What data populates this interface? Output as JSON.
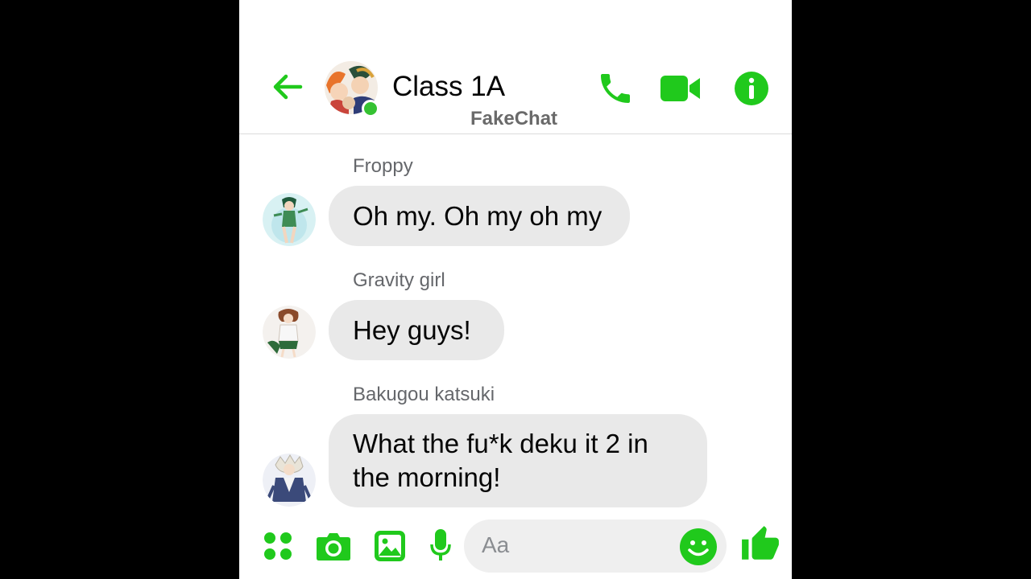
{
  "colors": {
    "accent": "#20c91c",
    "bubble": "#e9e9e9",
    "online": "#35c232",
    "name_gray": "#65676b"
  },
  "header": {
    "title": "Class 1A",
    "watermark": "FakeChat",
    "icons": [
      "back-arrow-icon",
      "phone-icon",
      "video-camera-icon",
      "info-icon"
    ]
  },
  "messages": [
    {
      "sender": "Froppy",
      "text": "Oh my. Oh my oh my"
    },
    {
      "sender": "Gravity girl",
      "text": "Hey guys!"
    },
    {
      "sender": "Bakugou katsuki",
      "text_lines": [
        "What the fu*k deku it 2 in",
        "the morning!"
      ]
    }
  ],
  "composer": {
    "placeholder": "Aa",
    "icons": [
      "apps-icon",
      "camera-icon",
      "gallery-icon",
      "microphone-icon",
      "emoji-icon",
      "thumbs-up-icon"
    ]
  }
}
